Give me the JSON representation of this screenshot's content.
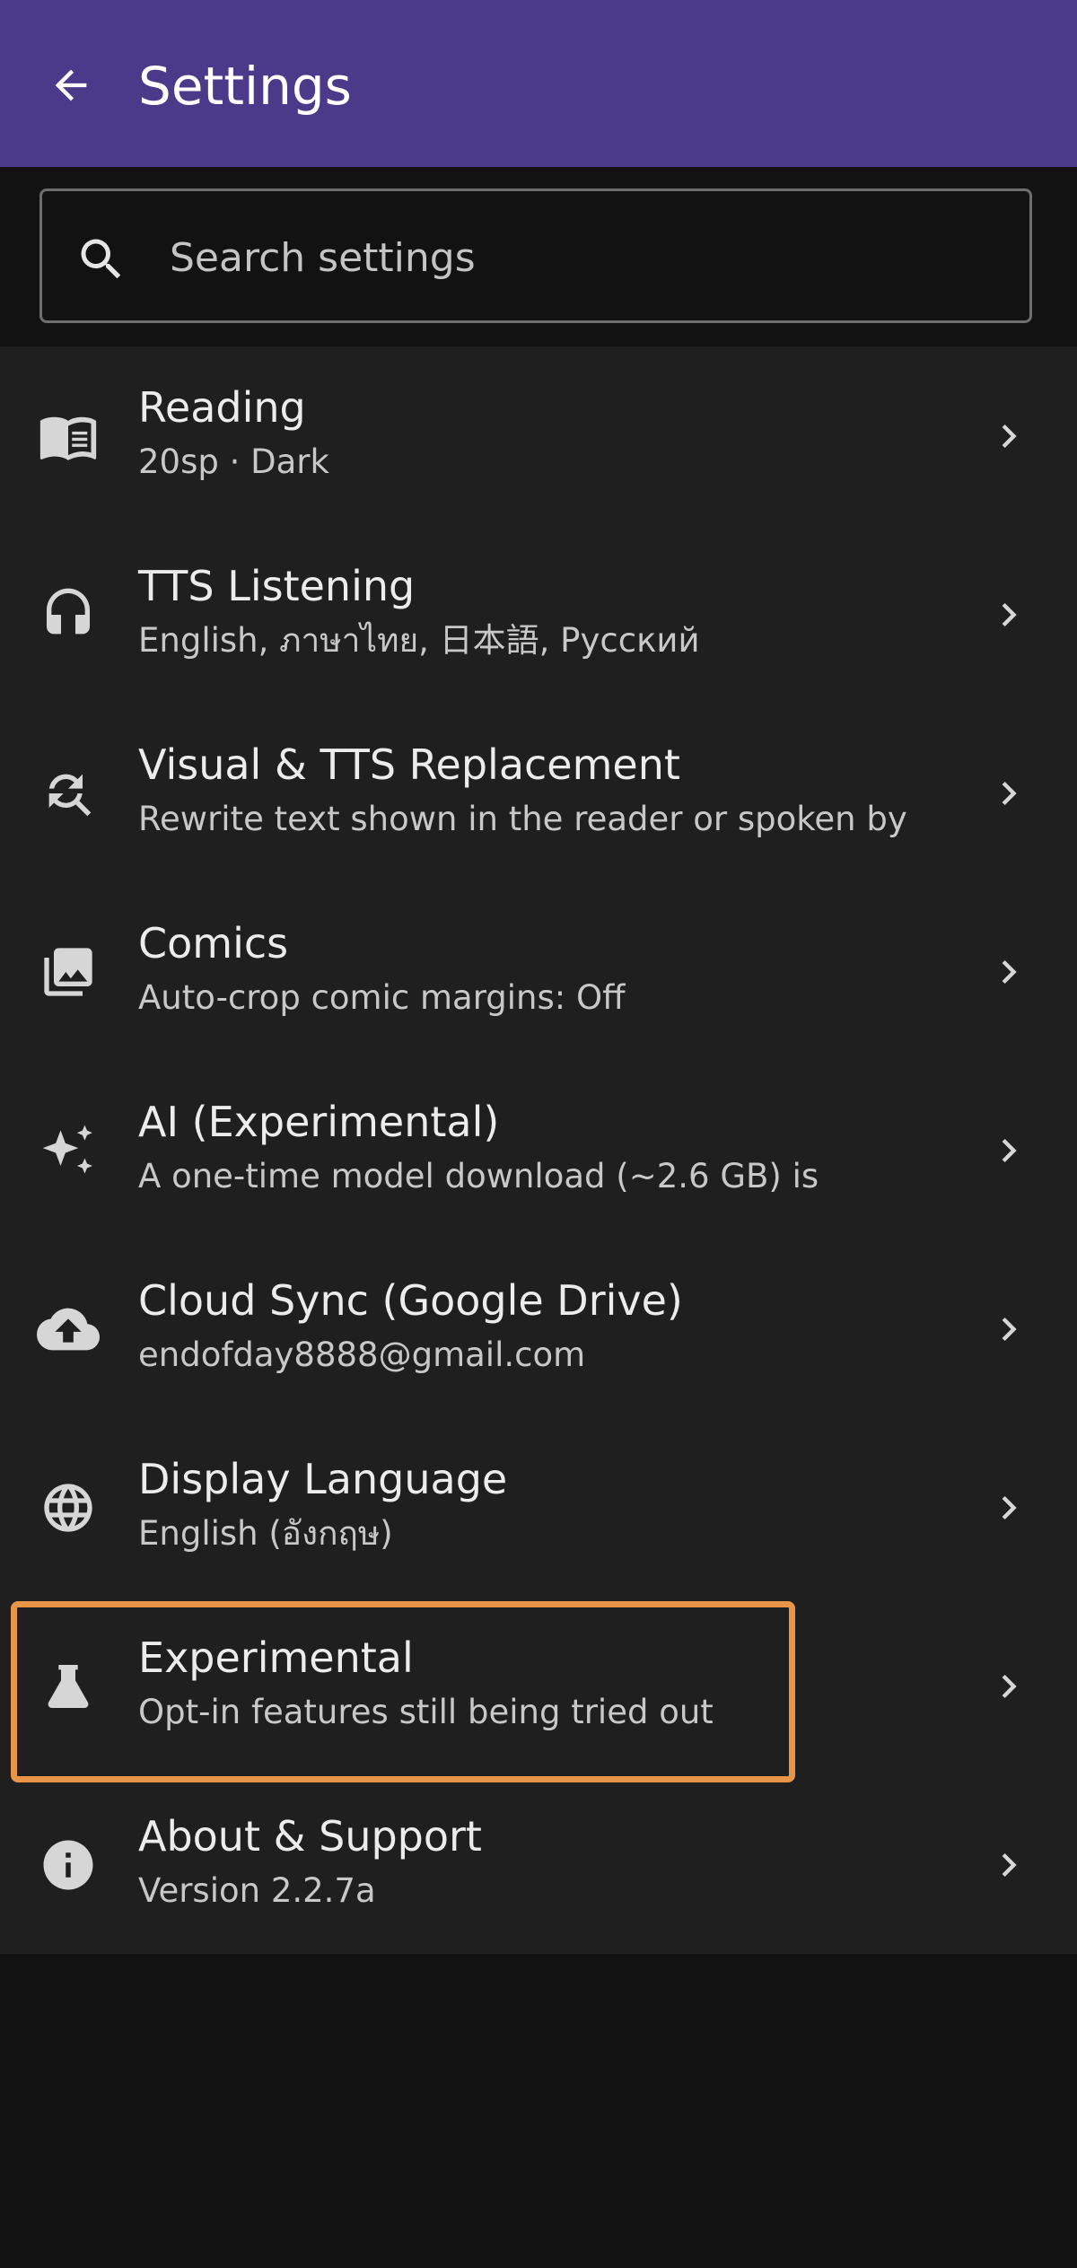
{
  "app_bar": {
    "title": "Settings",
    "back_icon": "arrow-back-icon"
  },
  "search": {
    "placeholder": "Search settings",
    "value": "",
    "icon": "search-icon"
  },
  "items": [
    {
      "id": "reading",
      "icon": "book-icon",
      "title": "Reading",
      "subtitle": "20sp · Dark"
    },
    {
      "id": "tts-listening",
      "icon": "headphones-icon",
      "title": "TTS Listening",
      "subtitle": "English, ภาษาไทย, 日本語, Русский"
    },
    {
      "id": "visual-tts-replacement",
      "icon": "find-replace-icon",
      "title": "Visual & TTS Replacement",
      "subtitle": "Rewrite text shown in the reader or spoken by"
    },
    {
      "id": "comics",
      "icon": "photo-library-icon",
      "title": "Comics",
      "subtitle": "Auto-crop comic margins: Off"
    },
    {
      "id": "ai-experimental",
      "icon": "sparkle-icon",
      "title": "AI (Experimental)",
      "subtitle": "A one-time model download (~2.6 GB) is"
    },
    {
      "id": "cloud-sync",
      "icon": "cloud-upload-icon",
      "title": "Cloud Sync (Google Drive)",
      "subtitle": "endofday8888@gmail.com"
    },
    {
      "id": "display-language",
      "icon": "globe-icon",
      "title": "Display Language",
      "subtitle": "English (อังกฤษ)"
    },
    {
      "id": "experimental",
      "icon": "flask-icon",
      "title": "Experimental",
      "subtitle": "Opt-in features still being tried out"
    },
    {
      "id": "about-support",
      "icon": "info-icon",
      "title": "About & Support",
      "subtitle": "Version 2.2.7a"
    }
  ],
  "colors": {
    "app_bar": "#4b398a",
    "background": "#121212",
    "list_background": "#1f1f1f",
    "highlight": "#e89548"
  }
}
